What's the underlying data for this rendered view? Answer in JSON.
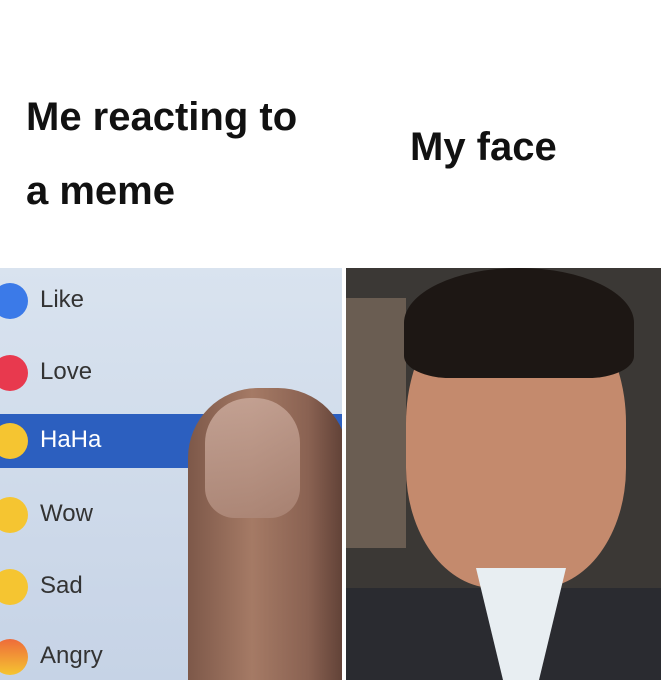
{
  "captions": {
    "left": "Me reacting to a meme",
    "right": "My face"
  },
  "reactions": [
    {
      "label": "Like",
      "icon": "like-icon",
      "selected": false
    },
    {
      "label": "Love",
      "icon": "love-icon",
      "selected": false
    },
    {
      "label": "HaHa",
      "icon": "haha-icon",
      "selected": true
    },
    {
      "label": "Wow",
      "icon": "wow-icon",
      "selected": false
    },
    {
      "label": "Sad",
      "icon": "sad-icon",
      "selected": false
    },
    {
      "label": "Angry",
      "icon": "angry-icon",
      "selected": false
    }
  ],
  "colors": {
    "selected_row": "#2c5fbf",
    "like": "#3b7ae8",
    "love": "#e8394e",
    "emoji_yellow": "#f5c531"
  }
}
